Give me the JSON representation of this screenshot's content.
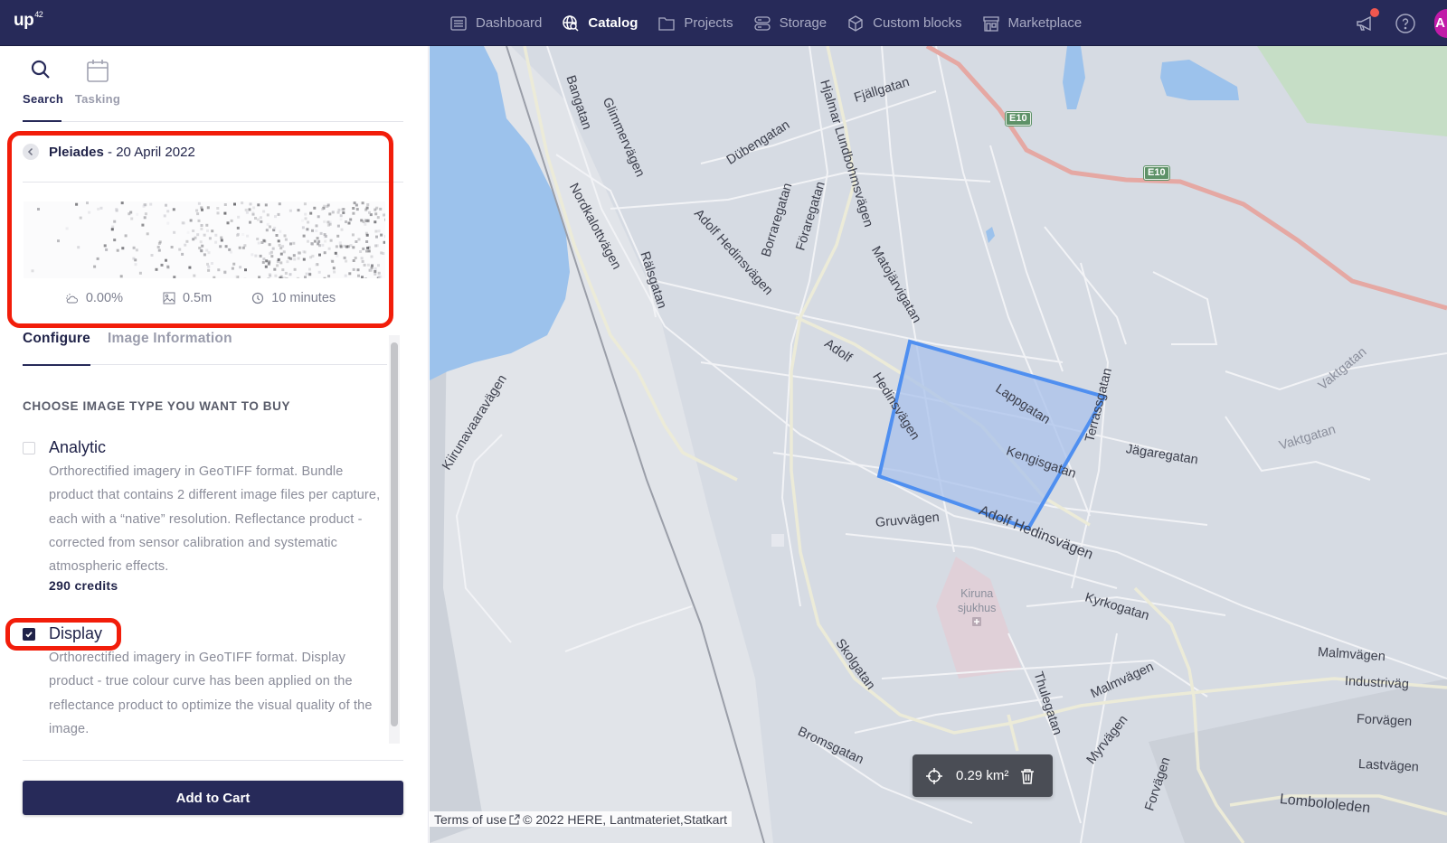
{
  "app": {
    "logo": "up",
    "logo_sup": "42"
  },
  "nav": {
    "items": [
      {
        "label": "Dashboard",
        "icon": "dashboard-icon",
        "active": false
      },
      {
        "label": "Catalog",
        "icon": "globe-search-icon",
        "active": true
      },
      {
        "label": "Projects",
        "icon": "folder-icon",
        "active": false
      },
      {
        "label": "Storage",
        "icon": "storage-icon",
        "active": false
      },
      {
        "label": "Custom blocks",
        "icon": "cube-icon",
        "active": false
      },
      {
        "label": "Marketplace",
        "icon": "store-icon",
        "active": false
      }
    ],
    "avatar_initial": "A",
    "notification_dot_color": "#f0574f"
  },
  "sidebar": {
    "mode_tabs": [
      {
        "label": "Search",
        "active": true
      },
      {
        "label": "Tasking",
        "active": false
      }
    ],
    "scene": {
      "sensor": "Pleiades",
      "separator": " - ",
      "date": "20 April 2022",
      "cloud_cover": "0.00%",
      "resolution": "0.5m",
      "delivery_time": "10 minutes"
    },
    "sub_tabs": [
      {
        "label": "Configure",
        "active": true
      },
      {
        "label": "Image Information",
        "active": false
      }
    ],
    "section_title": "CHOOSE IMAGE TYPE YOU WANT TO BUY",
    "options": [
      {
        "name": "Analytic",
        "checked": false,
        "description": "Orthorectified imagery in GeoTIFF format. Bundle product that contains 2 different image files per capture, each with a “native” resolution. Reflectance product - corrected from sensor calibration and systematic atmospheric effects.",
        "credits": "290 credits"
      },
      {
        "name": "Display",
        "checked": true,
        "description": "Orthorectified imagery in GeoTIFF format. Display product - true colour curve has been applied on the reflectance product to optimize the visual quality of the image."
      }
    ],
    "add_to_cart": "Add to Cart"
  },
  "map": {
    "area_readout": "0.29 km²",
    "terms_of_use": "Terms of use",
    "attribution": "© 2022 HERE, Lantmateriet,Statkart",
    "highway_shield": "E10",
    "poi": {
      "name_line1": "Kiruna",
      "name_line2": "sjukhus"
    },
    "road_labels": [
      "Bangatan",
      "Glimmervägen",
      "Nordkalottvägen",
      "Rälsgatan",
      "Dübengatan",
      "Hjalmar Lundbohmsvägen",
      "Fjällgatan",
      "Adolf Hedinsvägen",
      "Borraregatan",
      "Föraregatan",
      "Matojärvigatan",
      "Adolf",
      "Hedinsvägen",
      "Lappgatan",
      "Kengisgatan",
      "Terrassgatan",
      "Jägaregatan",
      "Vaktgatan",
      "Vaktgatan",
      "Gruvvägen",
      "Adolf Hedinsvägen",
      "Kiirunavaaravägen",
      "Kyrkogatan",
      "Skolgatan",
      "Thulegatan",
      "Malmvägen",
      "Malmvägen",
      "Industriväg",
      "Forvägen",
      "Lastvägen",
      "Lombololeden",
      "Bromsgatan",
      "Myrvägen",
      "Forvägen"
    ],
    "colors": {
      "land": "#d6dbe3",
      "water": "#9cc2ec",
      "aoi_fill": "#a9c2eb",
      "aoi_stroke": "#4f8ff0",
      "highway": "#e5a8a3",
      "park": "#c6dec6",
      "hospital": "#e0d0d8"
    }
  }
}
